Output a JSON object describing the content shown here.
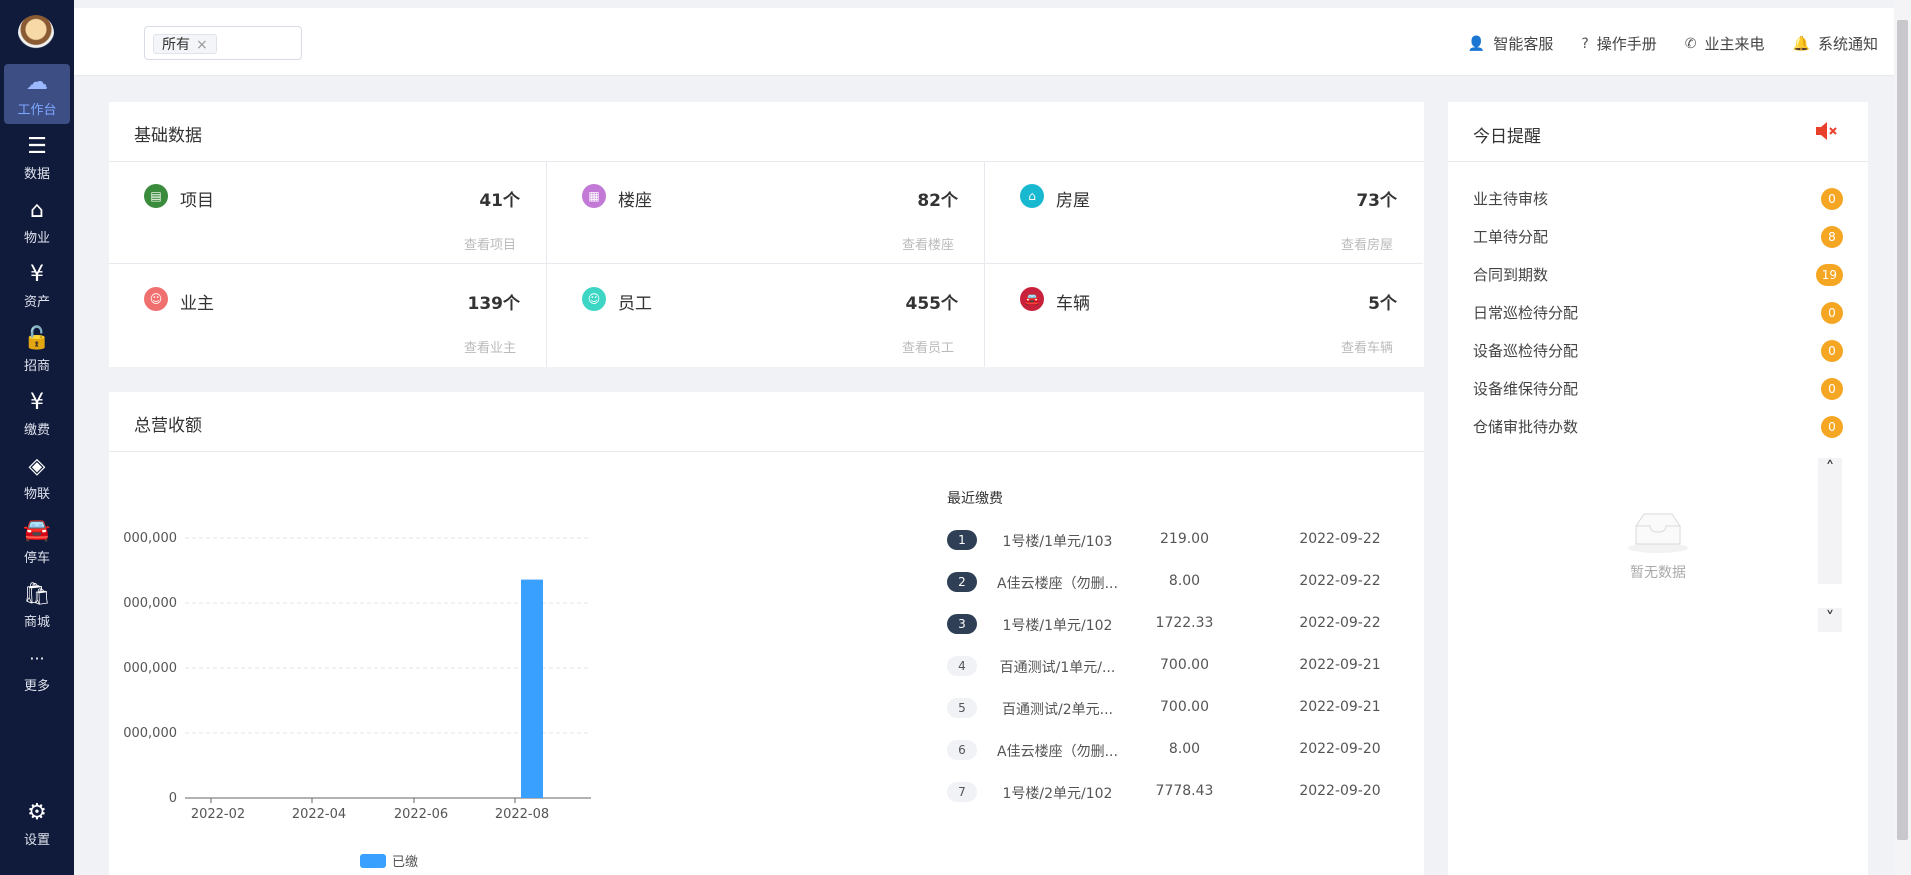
{
  "sidebar": {
    "items": [
      {
        "label": "工作台",
        "icon": "cloud-icon",
        "glyph": "☁"
      },
      {
        "label": "数据",
        "icon": "database-icon",
        "glyph": "☰"
      },
      {
        "label": "物业",
        "icon": "home-icon",
        "glyph": "⌂"
      },
      {
        "label": "资产",
        "icon": "yen-icon",
        "glyph": "¥"
      },
      {
        "label": "招商",
        "icon": "unlock-icon",
        "glyph": "🔓"
      },
      {
        "label": "缴费",
        "icon": "yen-tag-icon",
        "glyph": "¥"
      },
      {
        "label": "物联",
        "icon": "iot-icon",
        "glyph": "◈"
      },
      {
        "label": "停车",
        "icon": "car-icon",
        "glyph": "🚘"
      },
      {
        "label": "商城",
        "icon": "shopping-bag-icon",
        "glyph": "🛍"
      },
      {
        "label": "更多",
        "icon": "more-icon",
        "glyph": "···"
      }
    ],
    "settings": {
      "label": "设置",
      "icon": "gear-icon",
      "glyph": "⚙"
    }
  },
  "topbar": {
    "tag": "所有",
    "nav": [
      {
        "label": "智能客服",
        "icon": "user-icon",
        "glyph": "👤"
      },
      {
        "label": "操作手册",
        "icon": "help-icon",
        "glyph": "?"
      },
      {
        "label": "业主来电",
        "icon": "phone-icon",
        "glyph": "✆"
      },
      {
        "label": "系统通知",
        "icon": "bell-icon",
        "glyph": "🔔"
      }
    ]
  },
  "basic": {
    "title": "基础数据",
    "cells": [
      {
        "label": "项目",
        "value": "41个",
        "link": "查看项目",
        "color": "#3a8b3c",
        "glyph": "▤"
      },
      {
        "label": "楼座",
        "value": "82个",
        "link": "查看楼座",
        "color": "#c27ad6",
        "glyph": "▦"
      },
      {
        "label": "房屋",
        "value": "73个",
        "link": "查看房屋",
        "color": "#19b8d1",
        "glyph": "⌂"
      },
      {
        "label": "业主",
        "value": "139个",
        "link": "查看业主",
        "color": "#f07070",
        "glyph": "☺"
      },
      {
        "label": "员工",
        "value": "455个",
        "link": "查看员工",
        "color": "#3dd6c5",
        "glyph": "☺"
      },
      {
        "label": "车辆",
        "value": "5个",
        "link": "查看车辆",
        "color": "#c8213b",
        "glyph": "🚘"
      }
    ]
  },
  "revenue": {
    "title": "总营收额",
    "recent_title": "最近缴费",
    "recent": [
      {
        "rank": "1",
        "name": "1号楼/1单元/103",
        "amount": "219.00",
        "date": "2022-09-22"
      },
      {
        "rank": "2",
        "name": "A佳云楼座（勿删...",
        "amount": "8.00",
        "date": "2022-09-22"
      },
      {
        "rank": "3",
        "name": "1号楼/1单元/102",
        "amount": "1722.33",
        "date": "2022-09-22"
      },
      {
        "rank": "4",
        "name": "百通测试/1单元/...",
        "amount": "700.00",
        "date": "2022-09-21"
      },
      {
        "rank": "5",
        "name": "百通测试/2单元...",
        "amount": "700.00",
        "date": "2022-09-21"
      },
      {
        "rank": "6",
        "name": "A佳云楼座（勿删...",
        "amount": "8.00",
        "date": "2022-09-20"
      },
      {
        "rank": "7",
        "name": "1号楼/2单元/102",
        "amount": "7778.43",
        "date": "2022-09-20"
      }
    ]
  },
  "chart_data": {
    "type": "bar",
    "x_labels": [
      "2022-02",
      "2022-04",
      "2022-06",
      "2022-08"
    ],
    "y_tick_labels": [
      "0",
      "000,000",
      "000,000",
      "000,000",
      "000,000"
    ],
    "series": [
      {
        "name": "已缴",
        "color": "#3aa0ff",
        "values": [
          {
            "x": "2022-08",
            "value_fraction_of_top_tick": 0.84
          }
        ]
      }
    ],
    "grid": true,
    "legend_position": "bottom"
  },
  "remind": {
    "title": "今日提醒",
    "mute_icon": "speaker-mute-icon",
    "items": [
      {
        "label": "业主待审核",
        "count": "0"
      },
      {
        "label": "工单待分配",
        "count": "8"
      },
      {
        "label": "合同到期数",
        "count": "19"
      },
      {
        "label": "日常巡检待分配",
        "count": "0"
      },
      {
        "label": "设备巡检待分配",
        "count": "0"
      },
      {
        "label": "设备维保待分配",
        "count": "0"
      },
      {
        "label": "仓储审批待办数",
        "count": "0"
      }
    ],
    "empty_text": "暂无数据"
  }
}
